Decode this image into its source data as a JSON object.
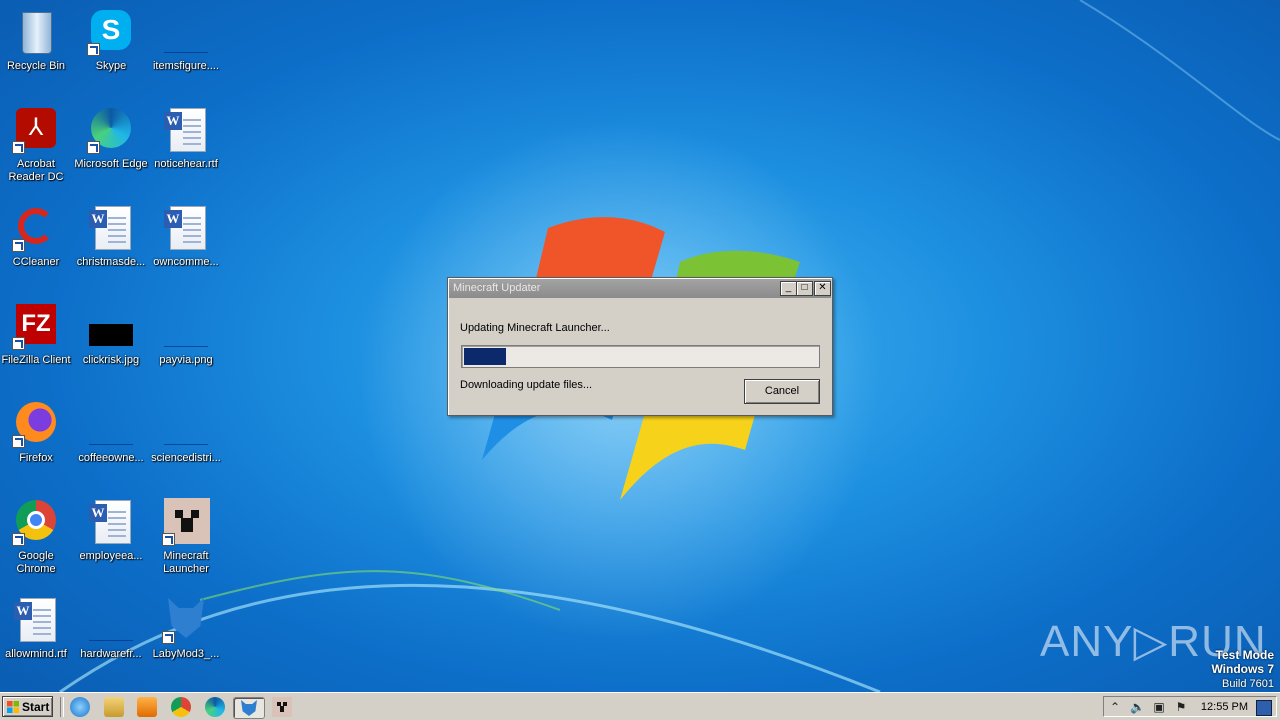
{
  "desktop": {
    "icons": [
      {
        "label": "Recycle Bin"
      },
      {
        "label": "Skype"
      },
      {
        "label": "itemsfigure...."
      },
      {
        "label": "Acrobat\nReader DC"
      },
      {
        "label": "Microsoft Edge"
      },
      {
        "label": "noticehear.rtf"
      },
      {
        "label": "CCleaner"
      },
      {
        "label": "christmasde..."
      },
      {
        "label": "owncomme..."
      },
      {
        "label": "FileZilla Client"
      },
      {
        "label": "clickrisk.jpg"
      },
      {
        "label": "payvia.png"
      },
      {
        "label": "Firefox"
      },
      {
        "label": "coffeeowne..."
      },
      {
        "label": "sciencedistri..."
      },
      {
        "label": "Google\nChrome"
      },
      {
        "label": "employeea..."
      },
      {
        "label": "Minecraft\nLauncher"
      },
      {
        "label": "allowmind.rtf"
      },
      {
        "label": "hardwarefr..."
      },
      {
        "label": "LabyMod3_..."
      }
    ]
  },
  "dialog": {
    "title": "Minecraft Updater",
    "minimize_label": "_",
    "maximize_label": "□",
    "close_label": "✕",
    "message": "Updating Minecraft Launcher...",
    "progress_fraction": 0.12,
    "status": "Downloading update files...",
    "cancel_label": "Cancel"
  },
  "taskbar": {
    "start_label": "Start",
    "clock": "12:55 PM"
  },
  "watermark": {
    "line1": "Test Mode",
    "line2": "Windows 7",
    "line3": "Build 7601",
    "brand": "ANY▷RUN"
  },
  "colors": {
    "progress_fill": "#0c2a6b",
    "dialog_bg": "#d4d0c8"
  }
}
